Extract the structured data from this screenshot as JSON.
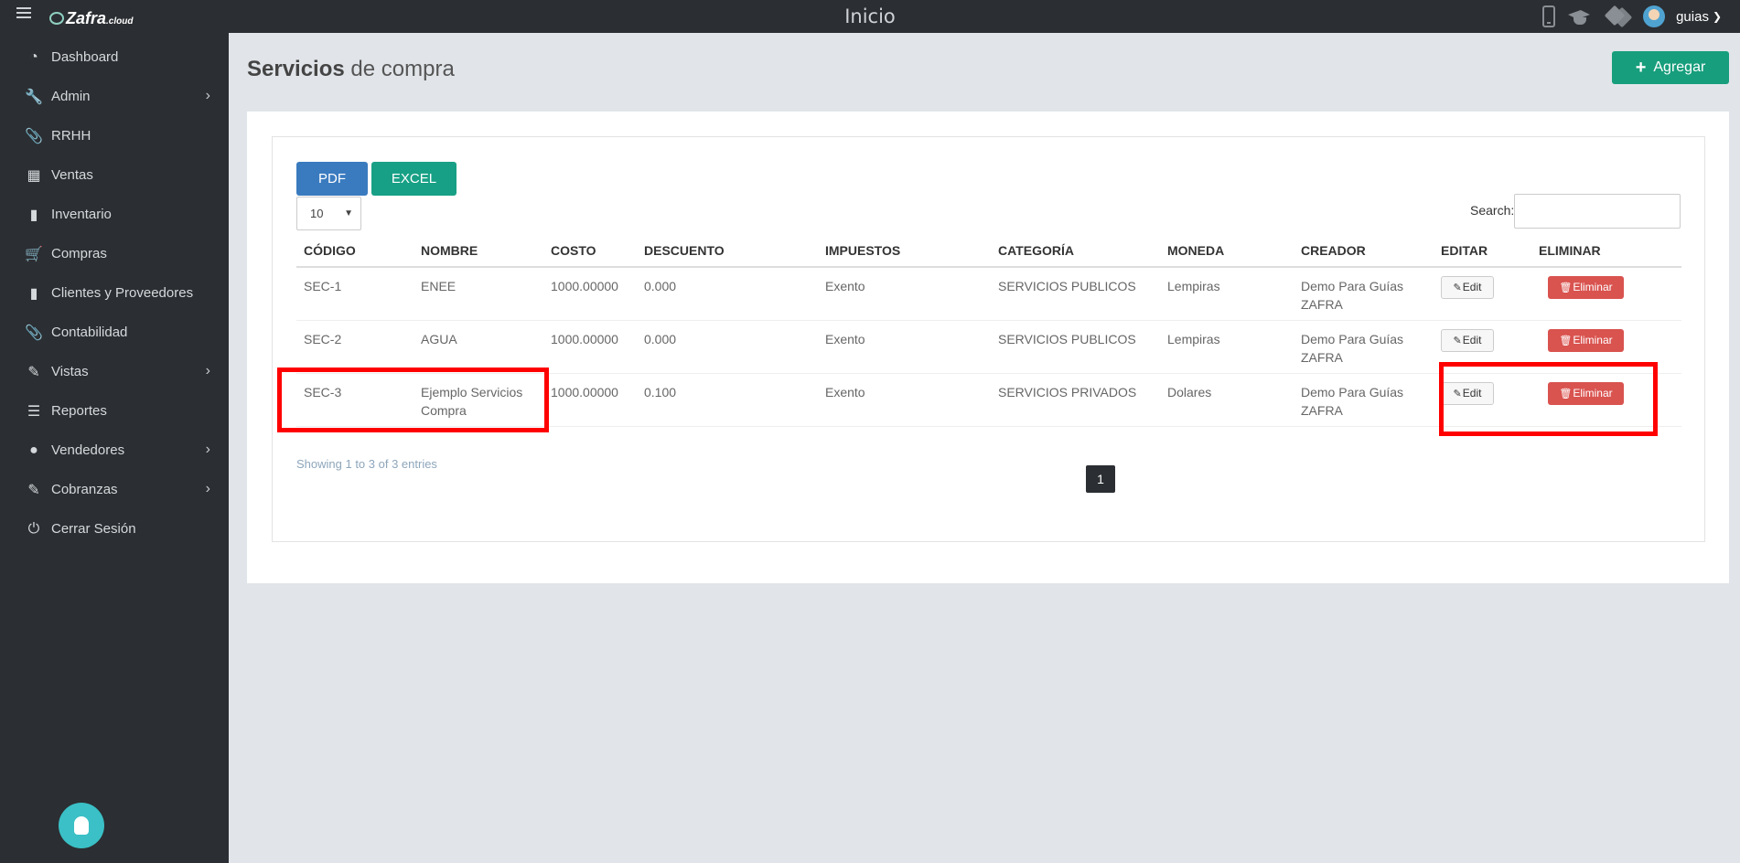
{
  "topbar": {
    "title": "Inicio",
    "logo_main": "Zafra",
    "logo_suffix": ".cloud",
    "user_name": "guias"
  },
  "sidebar": {
    "items": [
      {
        "label": "Dashboard",
        "icon": "dashboard-icon"
      },
      {
        "label": "Admin",
        "icon": "wrench-icon",
        "has_submenu": true
      },
      {
        "label": "RRHH",
        "icon": "paperclip-icon"
      },
      {
        "label": "Ventas",
        "icon": "money-icon"
      },
      {
        "label": "Inventario",
        "icon": "book-icon"
      },
      {
        "label": "Compras",
        "icon": "cart-icon"
      },
      {
        "label": "Clientes y Proveedores",
        "icon": "book-icon"
      },
      {
        "label": "Contabilidad",
        "icon": "paperclip-icon"
      },
      {
        "label": "Vistas",
        "icon": "edit-icon",
        "has_submenu": true
      },
      {
        "label": "Reportes",
        "icon": "list-icon"
      },
      {
        "label": "Vendedores",
        "icon": "user-icon",
        "has_submenu": true
      },
      {
        "label": "Cobranzas",
        "icon": "edit-icon",
        "has_submenu": true
      },
      {
        "label": "Cerrar Sesión",
        "icon": "power-icon"
      }
    ]
  },
  "page": {
    "title_strong": "Servicios",
    "title_light": "de compra",
    "add_label": "Agregar"
  },
  "toolbar": {
    "pdf_label": "PDF",
    "excel_label": "EXCEL",
    "page_size": "10",
    "search_label": "Search:",
    "search_value": ""
  },
  "table": {
    "headers": [
      "CÓDIGO",
      "NOMBRE",
      "COSTO",
      "DESCUENTO",
      "IMPUESTOS",
      "CATEGORÍA",
      "MONEDA",
      "CREADOR",
      "EDITAR",
      "ELIMINAR"
    ],
    "edit_label": "Edit",
    "delete_label": "Eliminar",
    "rows": [
      {
        "codigo": "SEC-1",
        "nombre": "ENEE",
        "costo": "1000.00000",
        "descuento": "0.000",
        "impuestos": "Exento",
        "categoria": "SERVICIOS PUBLICOS",
        "moneda": "Lempiras",
        "creador": "Demo Para Guías ZAFRA"
      },
      {
        "codigo": "SEC-2",
        "nombre": "AGUA",
        "costo": "1000.00000",
        "descuento": "0.000",
        "impuestos": "Exento",
        "categoria": "SERVICIOS PUBLICOS",
        "moneda": "Lempiras",
        "creador": "Demo Para Guías ZAFRA"
      },
      {
        "codigo": "SEC-3",
        "nombre": "Ejemplo Servicios Compra",
        "costo": "1000.00000",
        "descuento": "0.100",
        "impuestos": "Exento",
        "categoria": "SERVICIOS PRIVADOS",
        "moneda": "Dolares",
        "creador": "Demo Para Guías ZAFRA"
      }
    ]
  },
  "footer": {
    "showing": "Showing 1 to 3 of 3 entries",
    "current_page": "1"
  },
  "colors": {
    "accent_green": "#179e7c",
    "pdf_blue": "#3a7bbf",
    "danger_red": "#d9534f",
    "annotation_red": "#ff0000"
  }
}
